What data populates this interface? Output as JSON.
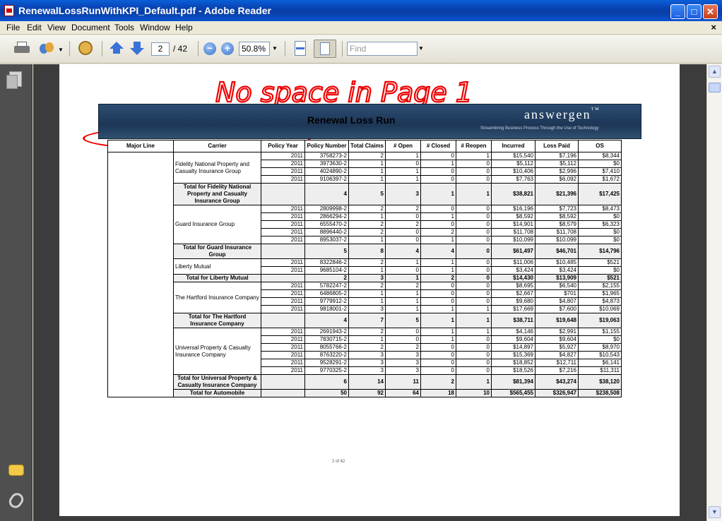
{
  "window": {
    "title": "RenewalLossRunWithKPI_Default.pdf - Adobe Reader",
    "minimize": "_",
    "maximize": "□",
    "close": "✕"
  },
  "menu": {
    "items": [
      "File",
      "Edit",
      "View",
      "Document",
      "Tools",
      "Window",
      "Help"
    ],
    "doc_close": "×"
  },
  "toolbar": {
    "page_current": "2",
    "page_total": "/ 42",
    "zoom": "50.8%",
    "zoom_out": "−",
    "zoom_in": "+",
    "find_placeholder": "Find"
  },
  "annotation": {
    "handwriting": "No space in Page 1"
  },
  "report": {
    "title": "Renewal Loss Run",
    "logo": "answergen",
    "logo_tm": "TM",
    "tagline": "Streamlining Business Process Through the Use of Technology",
    "footer": "2 of 42",
    "headers": [
      "Major Line",
      "Carrier",
      "Policy Year",
      "Policy Number",
      "Total Claims",
      "# Open",
      "# Closed",
      "# Reopen",
      "Incurred",
      "Loss Paid",
      "OS"
    ],
    "groups": [
      {
        "carrier": "Fidelity National Property and Casualty Insurance Group",
        "rows": [
          [
            "2011",
            "3758273-2",
            "2",
            "1",
            "0",
            "1",
            "$15,540",
            "$7,196",
            "$8,344"
          ],
          [
            "2011",
            "3973630-2",
            "1",
            "0",
            "1",
            "0",
            "$5,112",
            "$5,112",
            "$0"
          ],
          [
            "2011",
            "4024890-2",
            "1",
            "1",
            "0",
            "0",
            "$10,406",
            "$2,996",
            "$7,410"
          ],
          [
            "2011",
            "9106397-2",
            "1",
            "1",
            "0",
            "0",
            "$7,763",
            "$6,092",
            "$1,672"
          ]
        ],
        "total_label": "Total for Fidelity National Property and Casualty Insurance Group",
        "total": [
          "4",
          "5",
          "3",
          "1",
          "1",
          "$38,821",
          "$21,396",
          "$17,425"
        ]
      },
      {
        "carrier": "Guard Insurance Group",
        "rows": [
          [
            "2011",
            "2809998-2",
            "2",
            "2",
            "0",
            "0",
            "$16,196",
            "$7,723",
            "$8,473"
          ],
          [
            "2011",
            "2866294-2",
            "1",
            "0",
            "1",
            "0",
            "$8,592",
            "$8,592",
            "$0"
          ],
          [
            "2011",
            "6555470-2",
            "2",
            "2",
            "0",
            "0",
            "$14,901",
            "$8,579",
            "$6,323"
          ],
          [
            "2011",
            "8896440-2",
            "2",
            "0",
            "2",
            "0",
            "$11,708",
            "$11,708",
            "$0"
          ],
          [
            "2011",
            "8953037-2",
            "1",
            "0",
            "1",
            "0",
            "$10,099",
            "$10,099",
            "$0"
          ]
        ],
        "total_label": "Total for Guard Insurance Group",
        "total": [
          "5",
          "8",
          "4",
          "4",
          "0",
          "$61,497",
          "$46,701",
          "$14,796"
        ]
      },
      {
        "carrier": "Liberty Mutual",
        "rows": [
          [
            "2011",
            "8322846-2",
            "2",
            "1",
            "1",
            "0",
            "$11,006",
            "$10,485",
            "$521"
          ],
          [
            "2011",
            "9685104-2",
            "1",
            "0",
            "1",
            "0",
            "$3,424",
            "$3,424",
            "$0"
          ]
        ],
        "total_label": "Total for Liberty Mutual",
        "total": [
          "2",
          "3",
          "1",
          "2",
          "0",
          "$14,430",
          "$13,909",
          "$521"
        ]
      },
      {
        "carrier": "The Hartford Insurance Company",
        "rows": [
          [
            "2011",
            "5782247-2",
            "2",
            "2",
            "0",
            "0",
            "$8,695",
            "$6,540",
            "$2,155"
          ],
          [
            "2011",
            "6486805-2",
            "1",
            "1",
            "0",
            "0",
            "$2,667",
            "$701",
            "$1,965"
          ],
          [
            "2011",
            "9779912-2",
            "1",
            "1",
            "0",
            "0",
            "$9,680",
            "$4,807",
            "$4,873"
          ],
          [
            "2011",
            "9818001-2",
            "3",
            "1",
            "1",
            "1",
            "$17,669",
            "$7,600",
            "$10,069"
          ]
        ],
        "total_label": "Total for The Hartford Insurance Company",
        "total": [
          "4",
          "7",
          "5",
          "1",
          "1",
          "$38,711",
          "$19,648",
          "$19,063"
        ]
      },
      {
        "carrier": "Universal Property & Casualty Insurance Company",
        "rows": [
          [
            "2011",
            "2691943-2",
            "2",
            "0",
            "1",
            "1",
            "$4,146",
            "$2,991",
            "$1,155"
          ],
          [
            "2011",
            "7830715-2",
            "1",
            "0",
            "1",
            "0",
            "$9,604",
            "$9,604",
            "$0"
          ],
          [
            "2011",
            "8055766-2",
            "2",
            "2",
            "0",
            "0",
            "$14,897",
            "$5,927",
            "$8,970"
          ],
          [
            "2011",
            "8763220-2",
            "3",
            "3",
            "0",
            "0",
            "$15,369",
            "$4,827",
            "$10,543"
          ],
          [
            "2011",
            "9528291-2",
            "3",
            "3",
            "0",
            "0",
            "$18,852",
            "$12,711",
            "$6,141"
          ],
          [
            "2011",
            "9770325-2",
            "3",
            "3",
            "0",
            "0",
            "$18,526",
            "$7,216",
            "$11,311"
          ]
        ],
        "total_label": "Total for Universal Property & Casualty Insurance Company",
        "total": [
          "6",
          "14",
          "11",
          "2",
          "1",
          "$81,394",
          "$43,274",
          "$38,120"
        ]
      }
    ],
    "grand_total_label": "Total for Automobile",
    "grand_total": [
      "50",
      "92",
      "64",
      "18",
      "10",
      "$565,455",
      "$326,947",
      "$238,508"
    ]
  }
}
